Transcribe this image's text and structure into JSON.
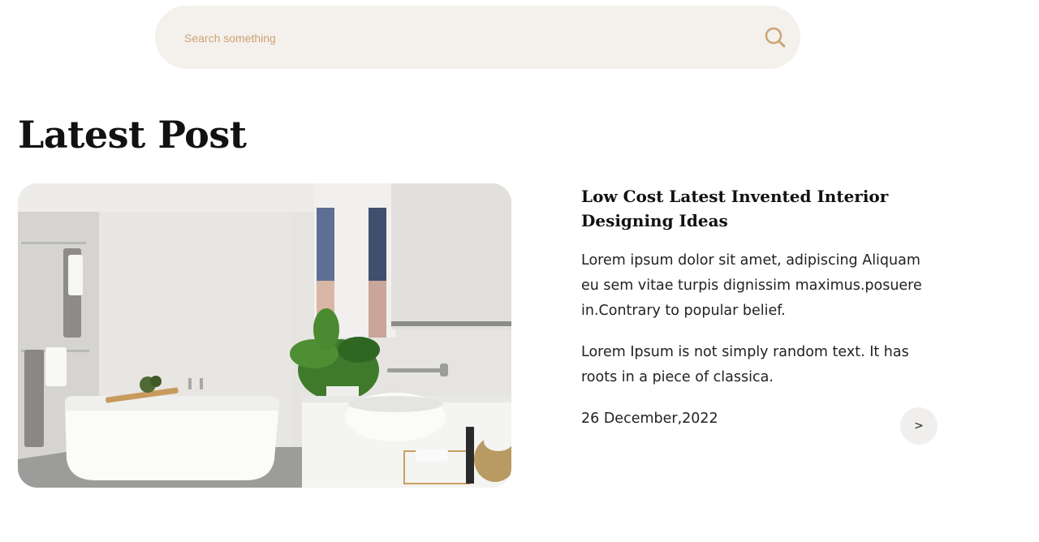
{
  "search": {
    "placeholder": "Search something",
    "icon": "search-icon",
    "accent_color": "#cda274",
    "background_color": "#f4f0ec"
  },
  "section": {
    "title": "Latest Post"
  },
  "post": {
    "image_alt": "Modern white bathroom with bathtub, vessel sink and plant",
    "title": "Low Cost Latest Invented Interior Designing Ideas",
    "paragraph_1": "Lorem ipsum dolor sit amet, adipiscing Aliquam eu sem vitae turpis dignissim maximus.posuere in.Contrary to popular belief.",
    "paragraph_2": "Lorem Ipsum is not simply random text. It has roots in a piece of classica.",
    "date": "26 December,2022",
    "next_label": ">"
  }
}
